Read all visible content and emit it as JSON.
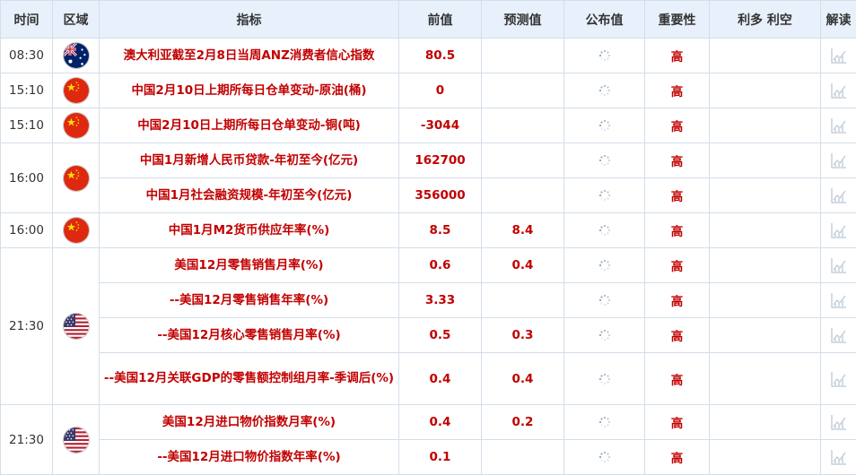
{
  "headers": [
    "时间",
    "区域",
    "指标",
    "前值",
    "预测值",
    "公布值",
    "重要性",
    "利多 利空",
    "解读"
  ],
  "colors": {
    "indicator": "#c20000",
    "header_bg": "#e8f1fb",
    "grid": "#d3deea"
  },
  "rows": [
    {
      "time": "08:30",
      "flag": "australia-flag",
      "indicator": "澳大利亚截至2月8日当周ANZ消费者信心指数",
      "previous": "80.5",
      "forecast": "",
      "importance": "高"
    },
    {
      "time": "15:10",
      "flag": "china-flag",
      "indicator": "中国2月10日上期所每日仓单变动-原油(桶)",
      "previous": "0",
      "forecast": "",
      "importance": "高"
    },
    {
      "time": "15:10",
      "flag": "china-flag",
      "indicator": "中国2月10日上期所每日仓单变动-铜(吨)",
      "previous": "-3044",
      "forecast": "",
      "importance": "高"
    },
    {
      "time": "16:00",
      "flag": "china-flag",
      "indicator": "中国1月新增人民币贷款-年初至今(亿元)",
      "previous": "162700",
      "forecast": "",
      "importance": "高"
    },
    {
      "time": "",
      "flag": "",
      "indicator": "中国1月社会融资规模-年初至今(亿元)",
      "previous": "356000",
      "forecast": "",
      "importance": "高"
    },
    {
      "time": "16:00",
      "flag": "china-flag",
      "indicator": "中国1月M2货币供应年率(%)",
      "previous": "8.5",
      "forecast": "8.4",
      "importance": "高"
    },
    {
      "time": "21:30",
      "flag": "usa-flag",
      "indicator": "美国12月零售销售月率(%)",
      "previous": "0.6",
      "forecast": "0.4",
      "importance": "高"
    },
    {
      "time": "",
      "flag": "",
      "indicator": "--美国12月零售销售年率(%)",
      "previous": "3.33",
      "forecast": "",
      "importance": "高"
    },
    {
      "time": "",
      "flag": "",
      "indicator": "--美国12月核心零售销售月率(%)",
      "previous": "0.5",
      "forecast": "0.3",
      "importance": "高"
    },
    {
      "time": "",
      "flag": "",
      "indicator": "--美国12月关联GDP的零售额控制组月率-季调后(%)",
      "previous": "0.4",
      "forecast": "0.4",
      "importance": "高"
    },
    {
      "time": "21:30",
      "flag": "usa-flag",
      "indicator": "美国12月进口物价指数月率(%)",
      "previous": "0.4",
      "forecast": "0.2",
      "importance": "高"
    },
    {
      "time": "",
      "flag": "",
      "indicator": "--美国12月进口物价指数年率(%)",
      "previous": "0.1",
      "forecast": "",
      "importance": "高"
    }
  ]
}
